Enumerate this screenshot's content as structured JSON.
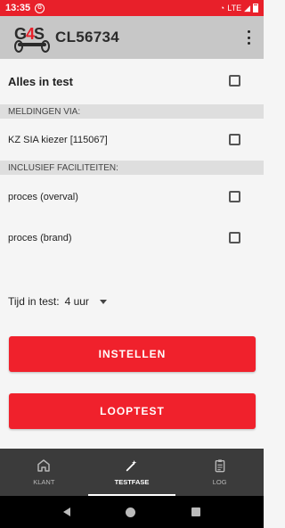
{
  "status_bar": {
    "time": "13:35",
    "network": "LTE"
  },
  "app_bar": {
    "logo_text": "G4S",
    "title": "CL56734"
  },
  "alles_in_test": {
    "label": "Alles in test",
    "checked": false
  },
  "meldingen": {
    "header": "MELDINGEN VIA:",
    "items": [
      {
        "label": "KZ SIA kiezer [115067]",
        "checked": false
      }
    ]
  },
  "faciliteiten": {
    "header": "INCLUSIEF FACILITEITEN:",
    "items": [
      {
        "label": "proces (overval)",
        "checked": false
      },
      {
        "label": "proces (brand)",
        "checked": false
      }
    ]
  },
  "tijd": {
    "label": "Tijd in test:",
    "value": "4 uur"
  },
  "buttons": {
    "instellen": "INSTELLEN",
    "looptest": "LOOPTEST"
  },
  "bottom_nav": {
    "items": [
      {
        "label": "KLANT",
        "icon": "home-icon",
        "active": false
      },
      {
        "label": "TESTFASE",
        "icon": "wand-icon",
        "active": true
      },
      {
        "label": "LOG",
        "icon": "clipboard-icon",
        "active": false
      }
    ]
  },
  "colors": {
    "accent": "#f0212c",
    "app_bar": "#c7c7c7",
    "nav_bg": "#3b3b3b"
  }
}
